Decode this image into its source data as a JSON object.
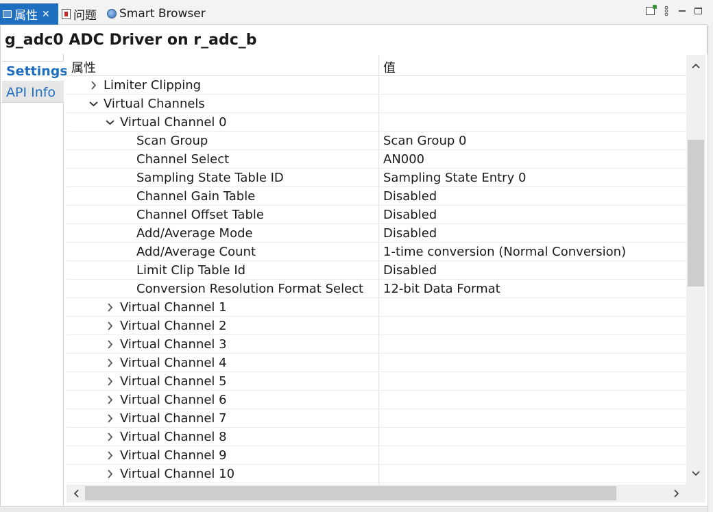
{
  "tabs": [
    {
      "label": "属性",
      "active": true,
      "icon": "properties-icon"
    },
    {
      "label": "问题",
      "active": false,
      "icon": "problems-icon"
    },
    {
      "label": "Smart Browser",
      "active": false,
      "icon": "globe-icon"
    }
  ],
  "close_glyph": "✕",
  "view_title": "g_adc0 ADC Driver on r_adc_b",
  "side_tabs": [
    {
      "label": "Settings",
      "active": true
    },
    {
      "label": "API Info",
      "active": false
    }
  ],
  "table": {
    "headers": {
      "property": "属性",
      "value": "值"
    },
    "rows": [
      {
        "level": 1,
        "expander": "collapsed",
        "name": "Limiter Clipping",
        "value": ""
      },
      {
        "level": 1,
        "expander": "expanded",
        "name": "Virtual Channels",
        "value": ""
      },
      {
        "level": 2,
        "expander": "expanded",
        "name": "Virtual Channel 0",
        "value": ""
      },
      {
        "level": 3,
        "expander": "none",
        "name": "Scan Group",
        "value": "Scan Group 0"
      },
      {
        "level": 3,
        "expander": "none",
        "name": "Channel Select",
        "value": "AN000"
      },
      {
        "level": 3,
        "expander": "none",
        "name": "Sampling State Table ID",
        "value": "Sampling State Entry 0"
      },
      {
        "level": 3,
        "expander": "none",
        "name": "Channel Gain Table",
        "value": "Disabled"
      },
      {
        "level": 3,
        "expander": "none",
        "name": "Channel Offset Table",
        "value": "Disabled"
      },
      {
        "level": 3,
        "expander": "none",
        "name": "Add/Average Mode",
        "value": "Disabled"
      },
      {
        "level": 3,
        "expander": "none",
        "name": "Add/Average Count",
        "value": "1-time conversion (Normal Conversion)"
      },
      {
        "level": 3,
        "expander": "none",
        "name": "Limit Clip Table Id",
        "value": "Disabled"
      },
      {
        "level": 3,
        "expander": "none",
        "name": "Conversion Resolution Format Select",
        "value": "12-bit Data Format"
      },
      {
        "level": 2,
        "expander": "collapsed",
        "name": "Virtual Channel 1",
        "value": ""
      },
      {
        "level": 2,
        "expander": "collapsed",
        "name": "Virtual Channel 2",
        "value": ""
      },
      {
        "level": 2,
        "expander": "collapsed",
        "name": "Virtual Channel 3",
        "value": ""
      },
      {
        "level": 2,
        "expander": "collapsed",
        "name": "Virtual Channel 4",
        "value": ""
      },
      {
        "level": 2,
        "expander": "collapsed",
        "name": "Virtual Channel 5",
        "value": ""
      },
      {
        "level": 2,
        "expander": "collapsed",
        "name": "Virtual Channel 6",
        "value": ""
      },
      {
        "level": 2,
        "expander": "collapsed",
        "name": "Virtual Channel 7",
        "value": ""
      },
      {
        "level": 2,
        "expander": "collapsed",
        "name": "Virtual Channel 8",
        "value": ""
      },
      {
        "level": 2,
        "expander": "collapsed",
        "name": "Virtual Channel 9",
        "value": ""
      },
      {
        "level": 2,
        "expander": "collapsed",
        "name": "Virtual Channel 10",
        "value": ""
      }
    ]
  },
  "colors": {
    "accent": "#1f6fc1",
    "header_bg": "#f3f3f3",
    "scroll_thumb": "#cdcdcd"
  },
  "window_controls": [
    "open-new-window-icon",
    "view-menu-icon",
    "minimize-icon",
    "maximize-icon"
  ]
}
